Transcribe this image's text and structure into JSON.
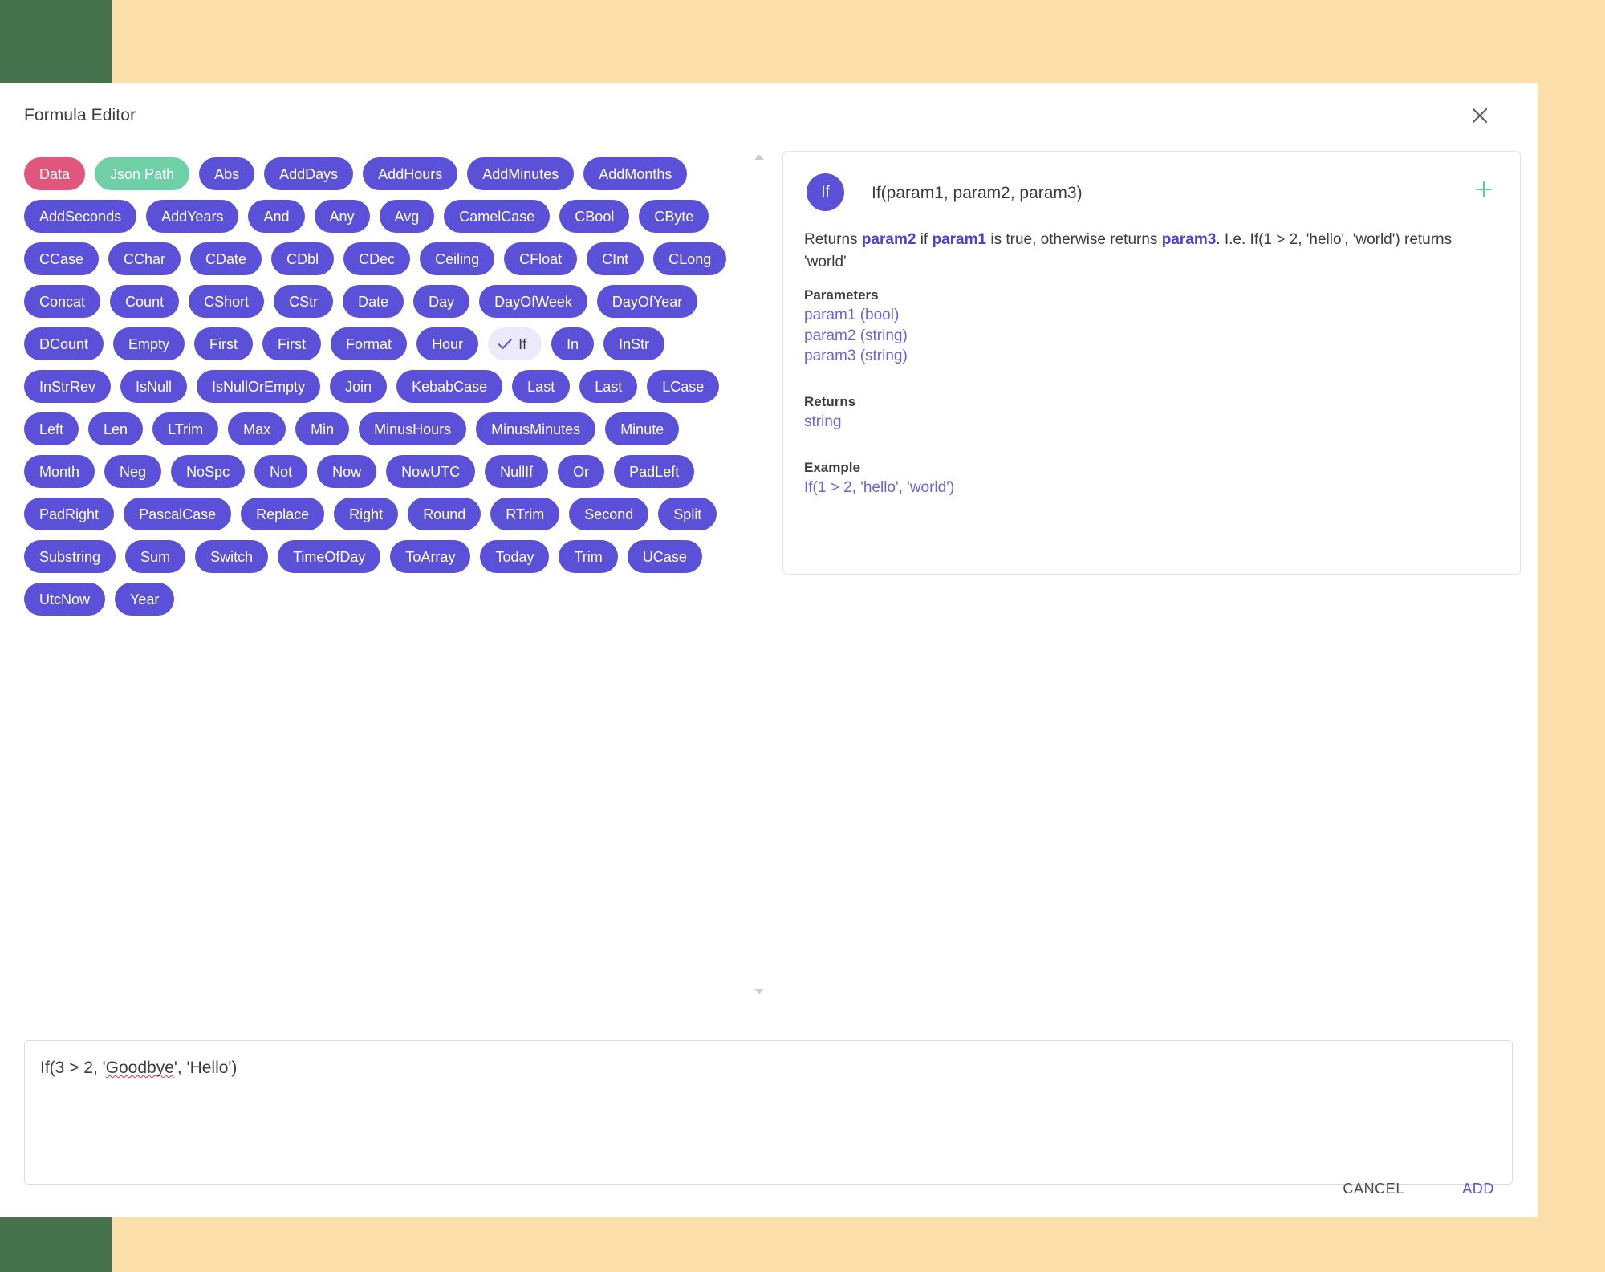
{
  "colors": {
    "chip_default": "#5b51d8",
    "chip_data": "#e2557c",
    "chip_jsonpath": "#6fcfa6",
    "chip_selected_bg": "#eceaf8",
    "accent_purple": "#5b51d8",
    "accent_green": "#5ecfa4",
    "page_backdrop": "#fcdeab",
    "page_sidebar": "#46724d"
  },
  "dialog": {
    "title": "Formula Editor",
    "close_icon": "close-icon"
  },
  "functions": [
    {
      "label": "Data",
      "style": "data"
    },
    {
      "label": "Json Path",
      "style": "jsonpath"
    },
    {
      "label": "Abs",
      "style": "default"
    },
    {
      "label": "AddDays",
      "style": "default"
    },
    {
      "label": "AddHours",
      "style": "default"
    },
    {
      "label": "AddMinutes",
      "style": "default"
    },
    {
      "label": "AddMonths",
      "style": "default"
    },
    {
      "label": "AddSeconds",
      "style": "default"
    },
    {
      "label": "AddYears",
      "style": "default"
    },
    {
      "label": "And",
      "style": "default"
    },
    {
      "label": "Any",
      "style": "default"
    },
    {
      "label": "Avg",
      "style": "default"
    },
    {
      "label": "CamelCase",
      "style": "default"
    },
    {
      "label": "CBool",
      "style": "default"
    },
    {
      "label": "CByte",
      "style": "default"
    },
    {
      "label": "CCase",
      "style": "default"
    },
    {
      "label": "CChar",
      "style": "default"
    },
    {
      "label": "CDate",
      "style": "default"
    },
    {
      "label": "CDbl",
      "style": "default"
    },
    {
      "label": "CDec",
      "style": "default"
    },
    {
      "label": "Ceiling",
      "style": "default"
    },
    {
      "label": "CFloat",
      "style": "default"
    },
    {
      "label": "CInt",
      "style": "default"
    },
    {
      "label": "CLong",
      "style": "default"
    },
    {
      "label": "Concat",
      "style": "default"
    },
    {
      "label": "Count",
      "style": "default"
    },
    {
      "label": "CShort",
      "style": "default"
    },
    {
      "label": "CStr",
      "style": "default"
    },
    {
      "label": "Date",
      "style": "default"
    },
    {
      "label": "Day",
      "style": "default"
    },
    {
      "label": "DayOfWeek",
      "style": "default"
    },
    {
      "label": "DayOfYear",
      "style": "default"
    },
    {
      "label": "DCount",
      "style": "default"
    },
    {
      "label": "Empty",
      "style": "default"
    },
    {
      "label": "First",
      "style": "default"
    },
    {
      "label": "First",
      "style": "default"
    },
    {
      "label": "Format",
      "style": "default"
    },
    {
      "label": "Hour",
      "style": "default"
    },
    {
      "label": "If",
      "style": "selected"
    },
    {
      "label": "In",
      "style": "default"
    },
    {
      "label": "InStr",
      "style": "default"
    },
    {
      "label": "InStrRev",
      "style": "default"
    },
    {
      "label": "IsNull",
      "style": "default"
    },
    {
      "label": "IsNullOrEmpty",
      "style": "default"
    },
    {
      "label": "Join",
      "style": "default"
    },
    {
      "label": "KebabCase",
      "style": "default"
    },
    {
      "label": "Last",
      "style": "default"
    },
    {
      "label": "Last",
      "style": "default"
    },
    {
      "label": "LCase",
      "style": "default"
    },
    {
      "label": "Left",
      "style": "default"
    },
    {
      "label": "Len",
      "style": "default"
    },
    {
      "label": "LTrim",
      "style": "default"
    },
    {
      "label": "Max",
      "style": "default"
    },
    {
      "label": "Min",
      "style": "default"
    },
    {
      "label": "MinusHours",
      "style": "default"
    },
    {
      "label": "MinusMinutes",
      "style": "default"
    },
    {
      "label": "Minute",
      "style": "default"
    },
    {
      "label": "Month",
      "style": "default"
    },
    {
      "label": "Neg",
      "style": "default"
    },
    {
      "label": "NoSpc",
      "style": "default"
    },
    {
      "label": "Not",
      "style": "default"
    },
    {
      "label": "Now",
      "style": "default"
    },
    {
      "label": "NowUTC",
      "style": "default"
    },
    {
      "label": "NullIf",
      "style": "default"
    },
    {
      "label": "Or",
      "style": "default"
    },
    {
      "label": "PadLeft",
      "style": "default"
    },
    {
      "label": "PadRight",
      "style": "default"
    },
    {
      "label": "PascalCase",
      "style": "default"
    },
    {
      "label": "Replace",
      "style": "default"
    },
    {
      "label": "Right",
      "style": "default"
    },
    {
      "label": "Round",
      "style": "default"
    },
    {
      "label": "RTrim",
      "style": "default"
    },
    {
      "label": "Second",
      "style": "default"
    },
    {
      "label": "Split",
      "style": "default"
    },
    {
      "label": "Substring",
      "style": "default"
    },
    {
      "label": "Sum",
      "style": "default"
    },
    {
      "label": "Switch",
      "style": "default"
    },
    {
      "label": "TimeOfDay",
      "style": "default"
    },
    {
      "label": "ToArray",
      "style": "default"
    },
    {
      "label": "Today",
      "style": "default"
    },
    {
      "label": "Trim",
      "style": "default"
    },
    {
      "label": "UCase",
      "style": "default"
    },
    {
      "label": "UtcNow",
      "style": "default"
    },
    {
      "label": "Year",
      "style": "default"
    }
  ],
  "scroll": {
    "up_icon": "chevron-up-icon",
    "down_icon": "chevron-down-icon"
  },
  "detail": {
    "avatar_label": "If",
    "signature": "If(param1, param2, param3)",
    "add_icon": "plus-icon",
    "description": {
      "part1": "Returns ",
      "bold1": "param2",
      "part2": " if ",
      "bold2": "param1",
      "part3": " is true, otherwise returns ",
      "bold3": "param3",
      "part4": ". I.e. If(1 > 2, 'hello', 'world') returns 'world'"
    },
    "parameters_heading": "Parameters",
    "parameters": [
      "param1 (bool)",
      "param2 (string)",
      "param3 (string)"
    ],
    "returns_heading": "Returns",
    "returns_value": "string",
    "example_heading": "Example",
    "example_value": "If(1 > 2, 'hello', 'world')"
  },
  "formula_input": {
    "value_before": "If(3 > 2, '",
    "value_misspelled": "Goodbye",
    "value_after": "', 'Hello')",
    "full_value": "If(3 > 2, 'Goodbye', 'Hello')",
    "placeholder": ""
  },
  "footer": {
    "cancel_label": "CANCEL",
    "add_label": "ADD"
  }
}
